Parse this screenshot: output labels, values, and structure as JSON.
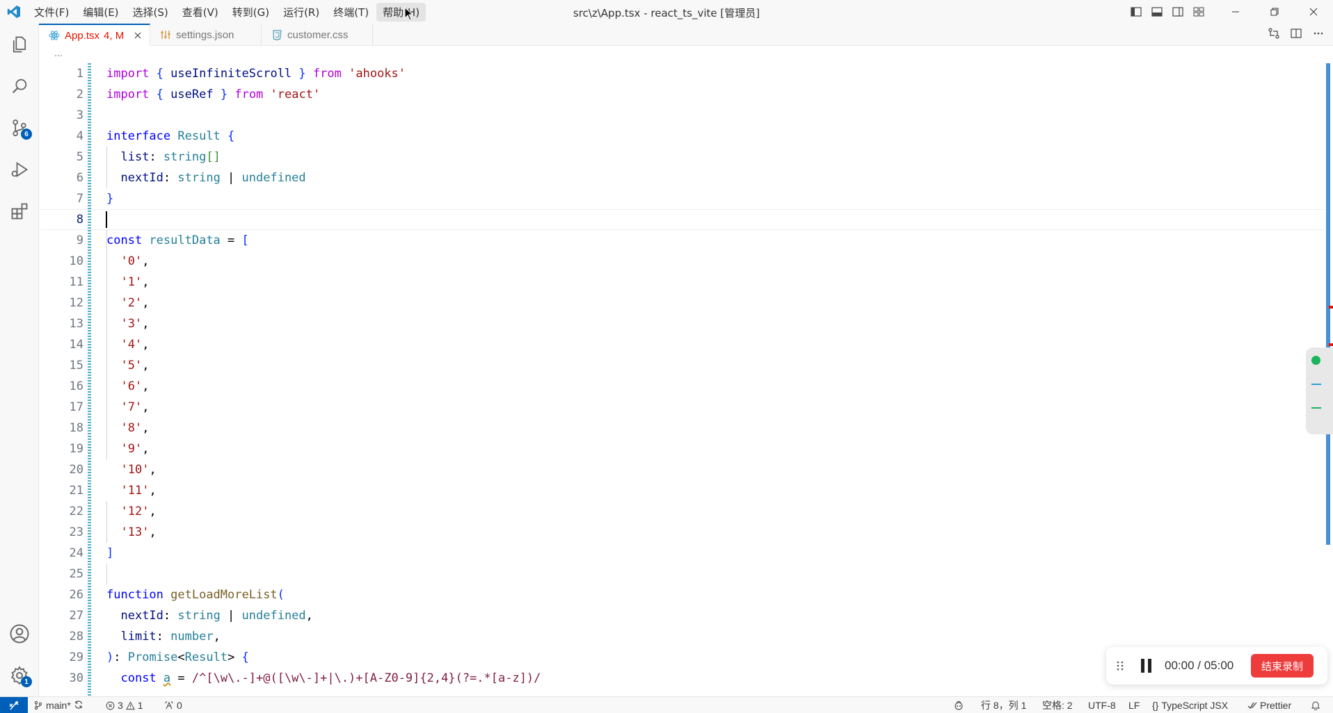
{
  "menu": [
    "文件(F)",
    "编辑(E)",
    "选择(S)",
    "查看(V)",
    "转到(G)",
    "运行(R)",
    "终端(T)",
    "帮助(H)"
  ],
  "window_title": "src\\z\\App.tsx - react_ts_vite [管理员]",
  "activity": {
    "source_control_badge": "6",
    "settings_badge": "1"
  },
  "tabs": [
    {
      "name": "App.tsx",
      "status": "4, M"
    },
    {
      "name": "settings.json"
    },
    {
      "name": "customer.css"
    }
  ],
  "breadcrumb": "...",
  "editor": {
    "current_line": 8,
    "lines": [
      "1",
      "2",
      "3",
      "4",
      "5",
      "6",
      "7",
      "8",
      "9",
      "10",
      "11",
      "12",
      "13",
      "14",
      "15",
      "16",
      "17",
      "18",
      "19",
      "20",
      "21",
      "22",
      "23",
      "24",
      "25",
      "26",
      "27",
      "28",
      "29",
      "30"
    ],
    "code": {
      "import": "import",
      "from": "from",
      "use_infinite_scroll": "useInfiniteScroll",
      "ahooks": "'ahooks'",
      "use_ref": "useRef",
      "react": "'react'",
      "interface": "interface",
      "result": "Result",
      "list": "list",
      "string": "string",
      "next_id": "nextId",
      "undefined": "undefined",
      "const": "const",
      "result_data": "resultData",
      "items": [
        "'0'",
        "'1'",
        "'2'",
        "'3'",
        "'4'",
        "'5'",
        "'6'",
        "'7'",
        "'8'",
        "'9'",
        "'10'",
        "'11'",
        "'12'",
        "'13'"
      ],
      "function": "function",
      "get_load_more_list": "getLoadMoreList",
      "limit": "limit",
      "number": "number",
      "promise": "Promise",
      "a": "a",
      "regex": "/^[\\w\\.-]+@([\\w\\-]+|\\.)+[A-Z0-9]{2,4}(?=.*[a-z])/"
    }
  },
  "recorder": {
    "time": "00:00 / 05:00",
    "stop_label": "结束录制"
  },
  "status": {
    "branch": "main*",
    "errors": "3",
    "warnings": "1",
    "ports": "0",
    "position": "行 8，列 1",
    "indent": "空格: 2",
    "encoding": "UTF-8",
    "eol": "LF",
    "language": "TypeScript JSX",
    "formatter": "Prettier"
  },
  "colors": {
    "accent": "#005fb8",
    "error_tab": "#e51400",
    "recorder_stop": "#ee3c3c"
  }
}
